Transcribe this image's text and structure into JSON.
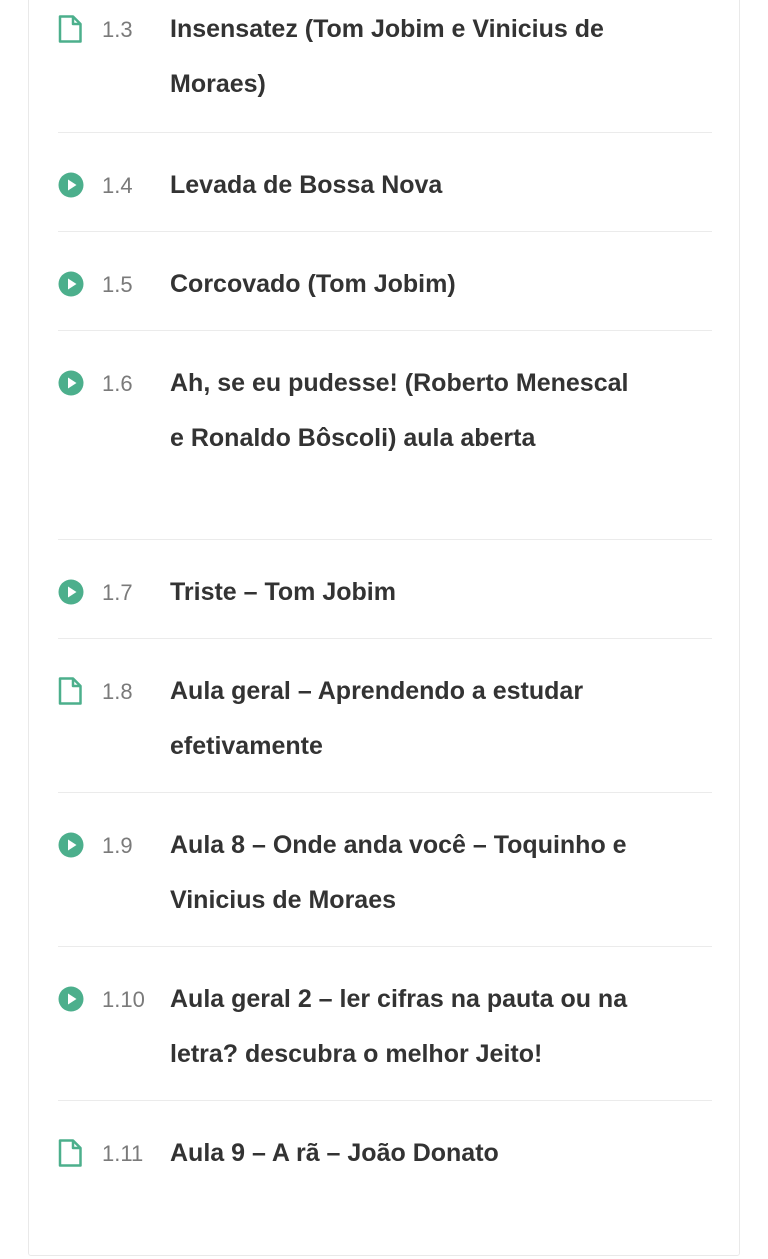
{
  "curriculum": {
    "accent_color": "#4caf8c",
    "lessons": [
      {
        "number": "1.3",
        "title": "Insensatez (Tom Jobim e Vinicius de Moraes)",
        "icon": "document-icon"
      },
      {
        "number": "1.4",
        "title": "Levada de Bossa Nova",
        "icon": "play-icon"
      },
      {
        "number": "1.5",
        "title": "Corcovado (Tom Jobim)",
        "icon": "play-icon"
      },
      {
        "number": "1.6",
        "title": "Ah, se eu pudesse! (Roberto Menescal e Ronaldo Bôscoli) aula aberta",
        "icon": "play-icon"
      },
      {
        "number": "1.7",
        "title": "Triste – Tom Jobim",
        "icon": "play-icon"
      },
      {
        "number": "1.8",
        "title": "Aula geral – Aprendendo a estudar efetivamente",
        "icon": "document-icon"
      },
      {
        "number": "1.9",
        "title": "Aula 8 – Onde anda você – Toquinho e Vinicius de Moraes",
        "icon": "play-icon"
      },
      {
        "number": "1.10",
        "title": "Aula geral 2 – ler cifras na pauta ou na letra? descubra o melhor Jeito!",
        "icon": "play-icon"
      },
      {
        "number": "1.11",
        "title": "Aula 9 – A rã – João Donato",
        "icon": "document-icon"
      }
    ]
  }
}
